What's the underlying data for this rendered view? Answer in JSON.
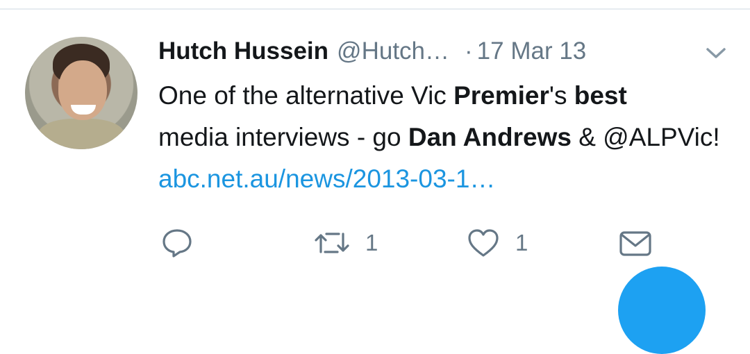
{
  "tweet": {
    "author_name": "Hutch Hussein",
    "author_handle": "@Hutch…",
    "separator": "·",
    "date": "17 Mar 13",
    "text_parts": {
      "p1": "One of the alternative Vic ",
      "p2": "Premier",
      "p3": "'s ",
      "p4": "best",
      "p5": " media interviews - go ",
      "p6": "Dan Andrews",
      "p7": " & @ALPVic! ",
      "link": "abc.net.au/news/2013-03-1…"
    }
  },
  "actions": {
    "reply_icon": "reply-icon",
    "retweet_icon": "retweet-icon",
    "retweet_count": "1",
    "like_icon": "heart-icon",
    "like_count": "1",
    "dm_icon": "envelope-icon"
  },
  "colors": {
    "link": "#1b95e0",
    "secondary_text": "#657786",
    "accent": "#1da1f2"
  }
}
